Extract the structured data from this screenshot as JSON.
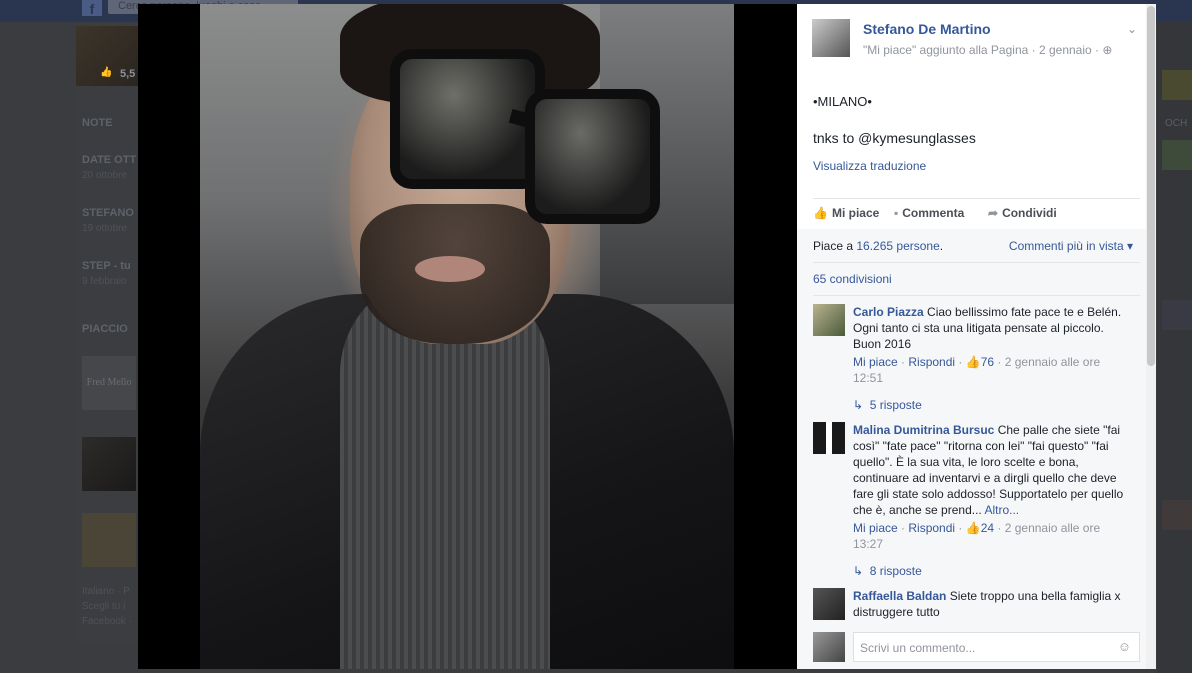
{
  "background": {
    "search_text": "Cerca persone, luoghi e cose",
    "likes_badge": "5,5",
    "section_note": "NOTE",
    "note_items": [
      {
        "title": "DATE OTT",
        "sub": "20 ottobre"
      },
      {
        "title": "STEFANO",
        "sub": "19 ottobre"
      },
      {
        "title": "STEP - tu",
        "sub": "9 febbraio"
      }
    ],
    "section_likes": "PIACCIO",
    "logo_text": "Fred Mello",
    "footer_lines": [
      "Italiano · P",
      "Scegli tu i",
      "Facebook ·"
    ],
    "right_label": "OCH"
  },
  "post": {
    "author": "Stefano De Martino",
    "subtitle": "\"Mi piace\" aggiunto alla Pagina · 2 gennaio ·",
    "line1": "•MILANO•",
    "line2": "tnks to @kymesunglasses",
    "translate": "Visualizza traduzione",
    "actions": {
      "like": "Mi piace",
      "comment": "Commenta",
      "share": "Condividi"
    },
    "likes_prefix": "Piace a",
    "likes_count": "16.265 persone",
    "likes_suffix": ".",
    "sort": "Commenti più in vista",
    "shares": "65 condivisioni"
  },
  "comments": [
    {
      "name": "Carlo Piazza",
      "text": "Ciao bellissimo fate pace te e Belén. Ogni tanto ci sta una litigata pensate al piccolo. Buon 2016",
      "like": "Mi piace",
      "reply": "Rispondi",
      "like_count": "76",
      "date": "2 gennaio alle ore 12:51",
      "replies": "5 risposte"
    },
    {
      "name": "Malina Dumitrina Bursuc",
      "text": "Che palle che siete \"fai così\" \"fate pace\" \"ritorna con lei\" \"fai questo\" \"fai quello\". È la sua vita, le loro scelte e bona, continuare ad inventarvi e a dirgli quello che deve fare gli state solo addosso! Supportatelo per quello che è, anche se prend...",
      "more": "Altro...",
      "like": "Mi piace",
      "reply": "Rispondi",
      "like_count": "24",
      "date": "2 gennaio alle ore 13:27",
      "replies": "8 risposte"
    },
    {
      "name": "Raffaella Baldan",
      "text": "Siete troppo una bella famiglia x distruggere tutto"
    }
  ],
  "compose": {
    "placeholder": "Scrivi un commento..."
  },
  "icons": {
    "like": "thumbs-up-icon",
    "comment": "speech-bubble-icon",
    "share": "share-arrow-icon",
    "globe": "globe-icon",
    "emoji": "smiley-icon",
    "reply": "reply-arrow-icon"
  }
}
